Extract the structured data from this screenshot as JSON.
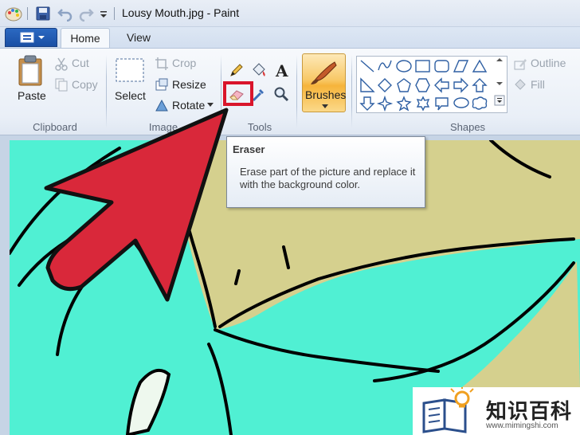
{
  "window": {
    "title": "Lousy Mouth.jpg - Paint"
  },
  "tabs": [
    {
      "label": "Home",
      "active": true
    },
    {
      "label": "View",
      "active": false
    }
  ],
  "clipboard": {
    "group_label": "Clipboard",
    "paste_label": "Paste",
    "cut_label": "Cut",
    "copy_label": "Copy"
  },
  "image": {
    "group_label": "Image",
    "select_label": "Select",
    "crop_label": "Crop",
    "resize_label": "Resize",
    "rotate_label": "Rotate"
  },
  "tools": {
    "group_label": "Tools",
    "items": [
      "pencil-icon",
      "fill-bucket-icon",
      "text-icon",
      "eraser-icon",
      "color-picker-icon",
      "magnifier-icon"
    ],
    "text_glyph": "A"
  },
  "brushes": {
    "label": "Brushes"
  },
  "shapes": {
    "group_label": "Shapes",
    "outline_label": "Outline",
    "fill_label": "Fill"
  },
  "tooltip": {
    "title": "Eraser",
    "body": "Erase part of the picture and replace it with the background color."
  },
  "watermark": {
    "brand_cn": "知识百科",
    "url": "www.mimingshi.com"
  },
  "colors": {
    "highlight": "#d9152b",
    "arrow": "#d9283a",
    "canvas_cyan": "#50f0d3",
    "canvas_khaki": "#d5d08e",
    "file_button": "#1f58b0"
  }
}
